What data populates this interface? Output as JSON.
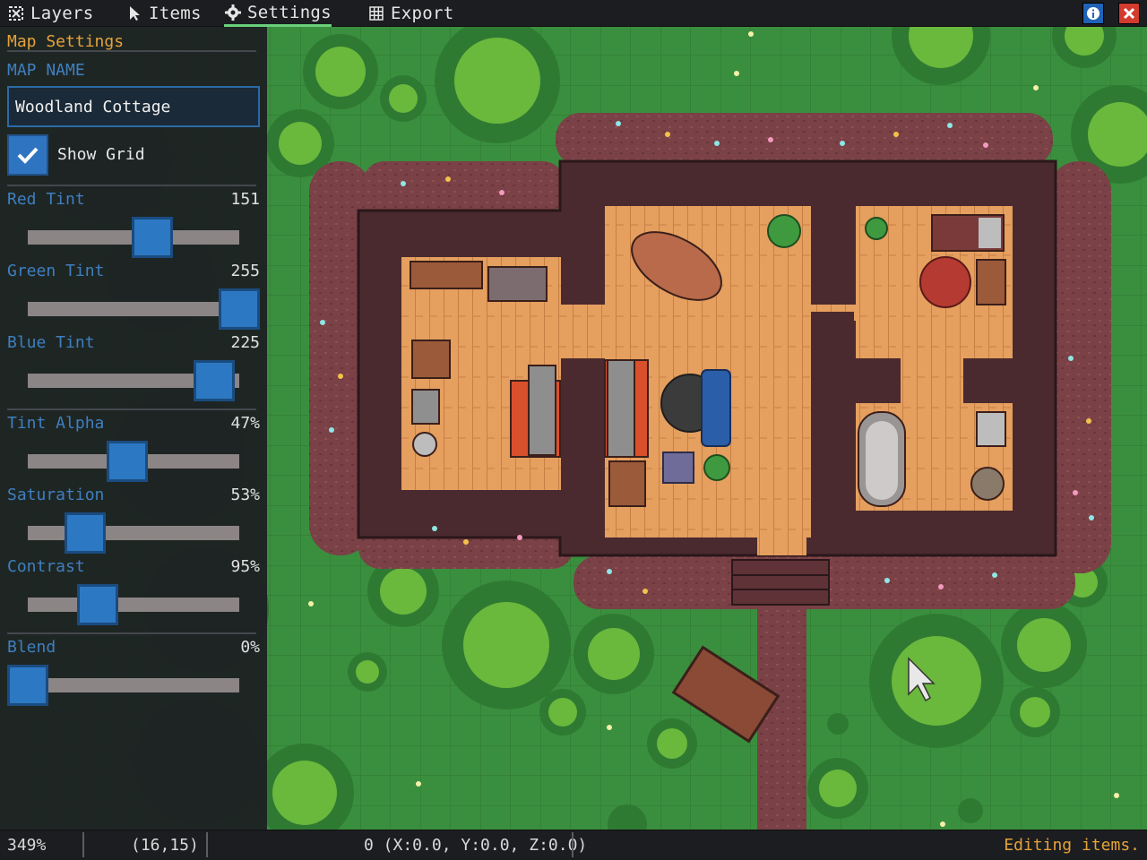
{
  "tabs": [
    {
      "label": "Layers",
      "icon": "layers-icon"
    },
    {
      "label": "Items",
      "icon": "cursor-icon"
    },
    {
      "label": "Settings",
      "icon": "gear-icon",
      "active": true
    },
    {
      "label": "Export",
      "icon": "grid-icon"
    }
  ],
  "window_buttons": {
    "info": "info-icon",
    "close": "close-icon"
  },
  "panel": {
    "title": "Map Settings",
    "map_name_label": "MAP NAME",
    "map_name_value": "Woodland Cottage",
    "show_grid_label": "Show Grid",
    "show_grid_checked": true,
    "sliders": [
      {
        "label": "Red Tint",
        "value": "151",
        "level": 0.59
      },
      {
        "label": "Green Tint",
        "value": "255",
        "level": 1.0
      },
      {
        "label": "Blue Tint",
        "value": "225",
        "level": 0.88
      },
      {
        "label": "Tint Alpha",
        "value": "47%",
        "level": 0.47
      },
      {
        "label": "Saturation",
        "value": "53%",
        "level": 0.27
      },
      {
        "label": "Contrast",
        "value": "95%",
        "level": 0.33
      },
      {
        "label": "Blend",
        "value": "0%",
        "level": 0.0
      }
    ]
  },
  "status": {
    "zoom": "349%",
    "cell": "(16,15)",
    "selection": "0 (X:0.0, Y:0.0, Z:0.0)",
    "message": "Editing items."
  },
  "colors": {
    "accent_orange": "#e6a23a",
    "label_blue": "#3f7fbf",
    "slider_thumb": "#2d78c3",
    "active_tab_underline": "#6ad07b",
    "grass": "#3a8f3e",
    "floor": "#e59f5f",
    "wall": "#4a2a2e"
  }
}
